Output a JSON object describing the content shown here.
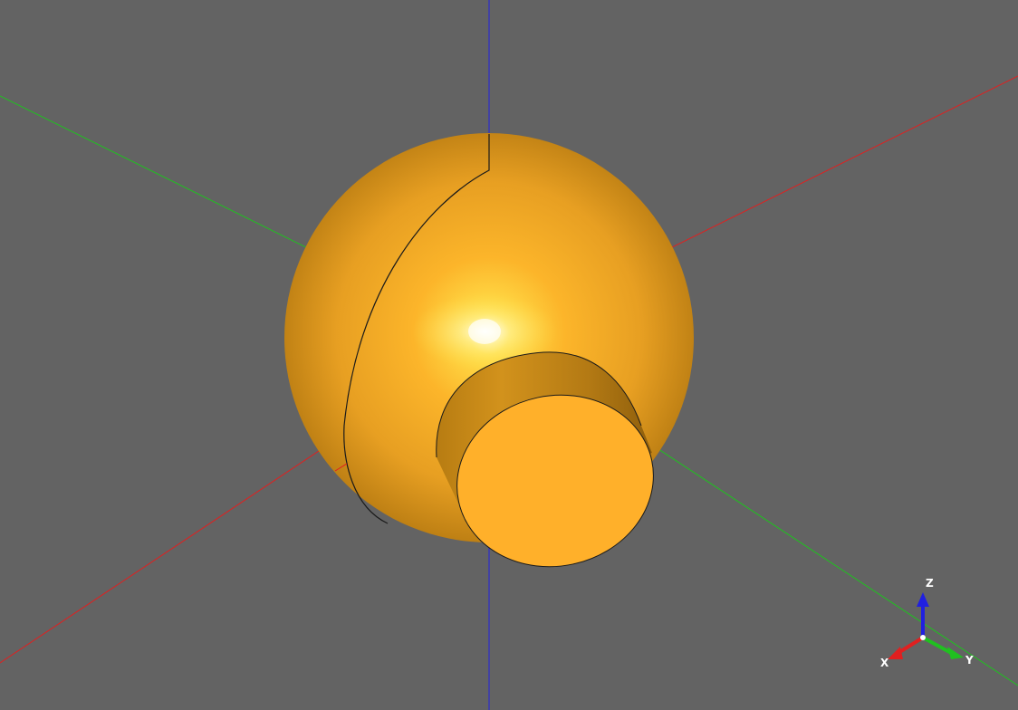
{
  "viewer": {
    "background_color": "#636363"
  },
  "axes": {
    "x_color": "#e02020",
    "y_color": "#20c020",
    "z_color": "#2020e0"
  },
  "model": {
    "shape": "sphere with cylindrical boss",
    "face_color": "#ffb02a",
    "edge_color": "#1a1a1a"
  },
  "triad": {
    "x_label": "X",
    "y_label": "Y",
    "z_label": "Z",
    "x_icon": "arrow-x-icon",
    "y_icon": "arrow-y-icon",
    "z_icon": "arrow-z-icon"
  }
}
